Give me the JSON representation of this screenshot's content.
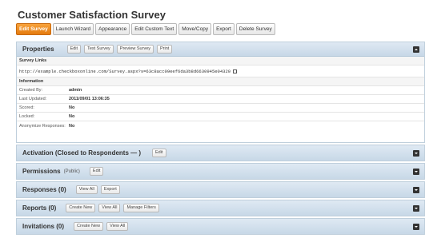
{
  "title": "Customer Satisfaction Survey",
  "toolbar": [
    "Edit Survey",
    "Launch Wizard",
    "Appearance",
    "Edit Custom Text",
    "Move/Copy",
    "Export",
    "Delete Survey"
  ],
  "properties": {
    "title": "Properties",
    "buttons": [
      "Edit",
      "Test Survey",
      "Preview Survey",
      "Print"
    ],
    "survey_links_label": "Survey Links",
    "survey_link": "http://example.checkboxonline.com/Survey.aspx?s=63c8acc09eef6da3b8d6630945e04320",
    "information_label": "Information",
    "info": [
      {
        "label": "Created By:",
        "value": "admin"
      },
      {
        "label": "Last Updated:",
        "value": "2011/09/01 13:06:35"
      },
      {
        "label": "Scored:",
        "value": "No"
      },
      {
        "label": "Locked:",
        "value": "No"
      },
      {
        "label": "Anonymize Responses:",
        "value": "No"
      }
    ]
  },
  "activation": {
    "title": "Activation (Closed to Respondents — )",
    "buttons": [
      "Edit"
    ]
  },
  "permissions": {
    "title": "Permissions",
    "note": "(Public)",
    "buttons": [
      "Edit"
    ]
  },
  "responses": {
    "title": "Responses (0)",
    "buttons": [
      "View All",
      "Export"
    ]
  },
  "reports": {
    "title": "Reports (0)",
    "buttons": [
      "Create New",
      "View All",
      "Manage Filters"
    ]
  },
  "invitations": {
    "title": "Invitations (0)",
    "buttons": [
      "Create New",
      "View All"
    ]
  }
}
